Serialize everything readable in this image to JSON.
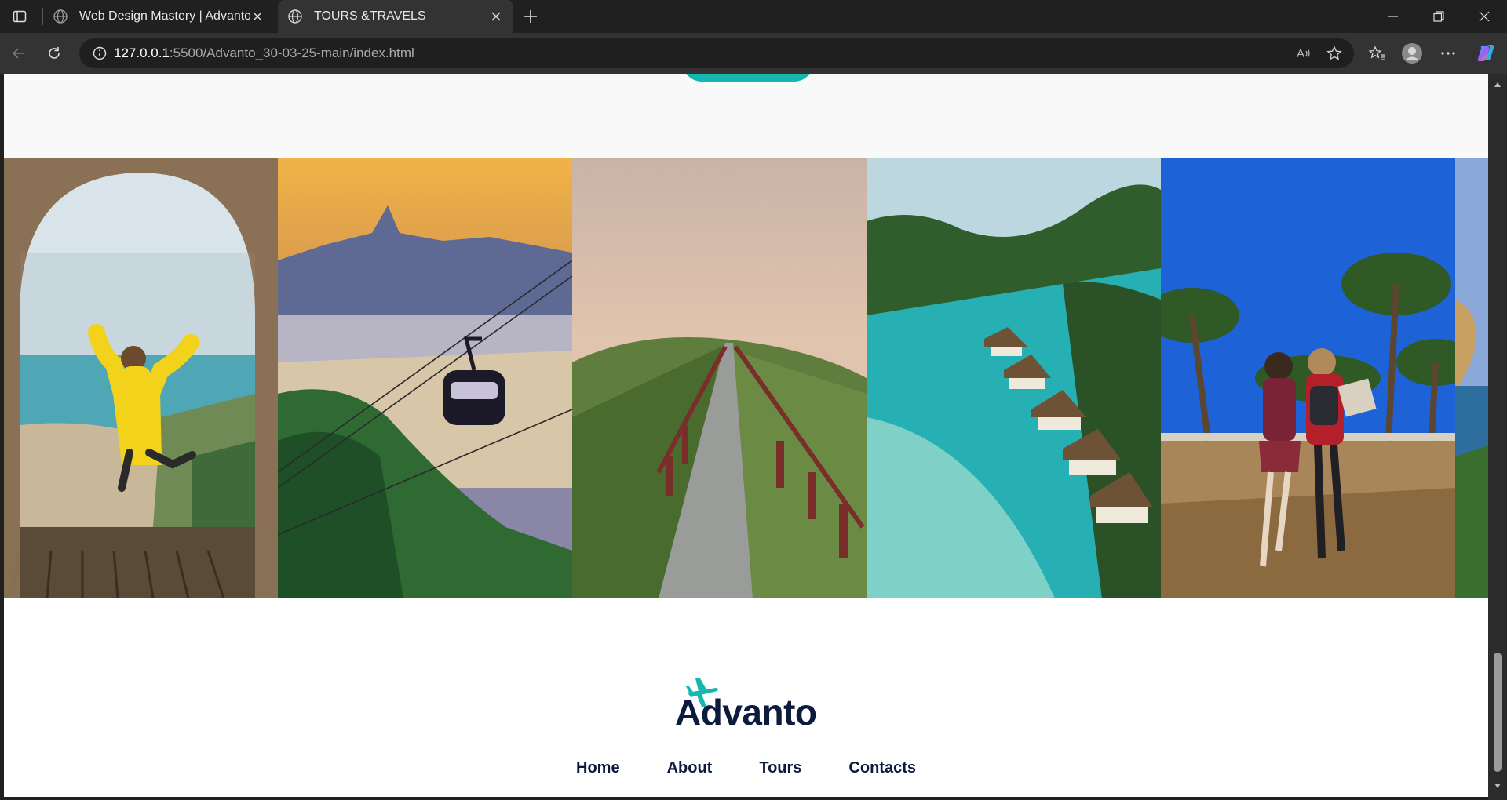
{
  "browser": {
    "tabs": [
      {
        "title": "Web Design Mastery | Advanto",
        "active": false
      },
      {
        "title": "TOURS &TRAVELS",
        "active": true
      }
    ],
    "url_host": "127.0.0.1",
    "url_rest": ":5500/Advanto_30-03-25-main/index.html"
  },
  "gallery": {
    "photos": [
      {
        "alt": "Woman in yellow jacket jumping under a stone arch above a bay",
        "icon": "photo-jump-arch"
      },
      {
        "alt": "Cable car over Rio de Janeiro at sunset",
        "icon": "photo-cable-car"
      },
      {
        "alt": "Stone path with red fence on a green hill",
        "icon": "photo-hill-path"
      },
      {
        "alt": "Overwater huts in turquoise lagoon",
        "icon": "photo-lagoon-huts"
      },
      {
        "alt": "Two travelers walking under palm trees",
        "icon": "photo-palm-walk"
      },
      {
        "alt": "Coastal island view",
        "icon": "photo-coast"
      }
    ]
  },
  "footer": {
    "logo_text": "Advanto",
    "nav": [
      "Home",
      "About",
      "Tours",
      "Contacts"
    ]
  },
  "colors": {
    "accent": "#14b8b1",
    "brand_navy": "#0b1a3d",
    "chrome_bg": "#202020",
    "toolbar_bg": "#333333"
  }
}
